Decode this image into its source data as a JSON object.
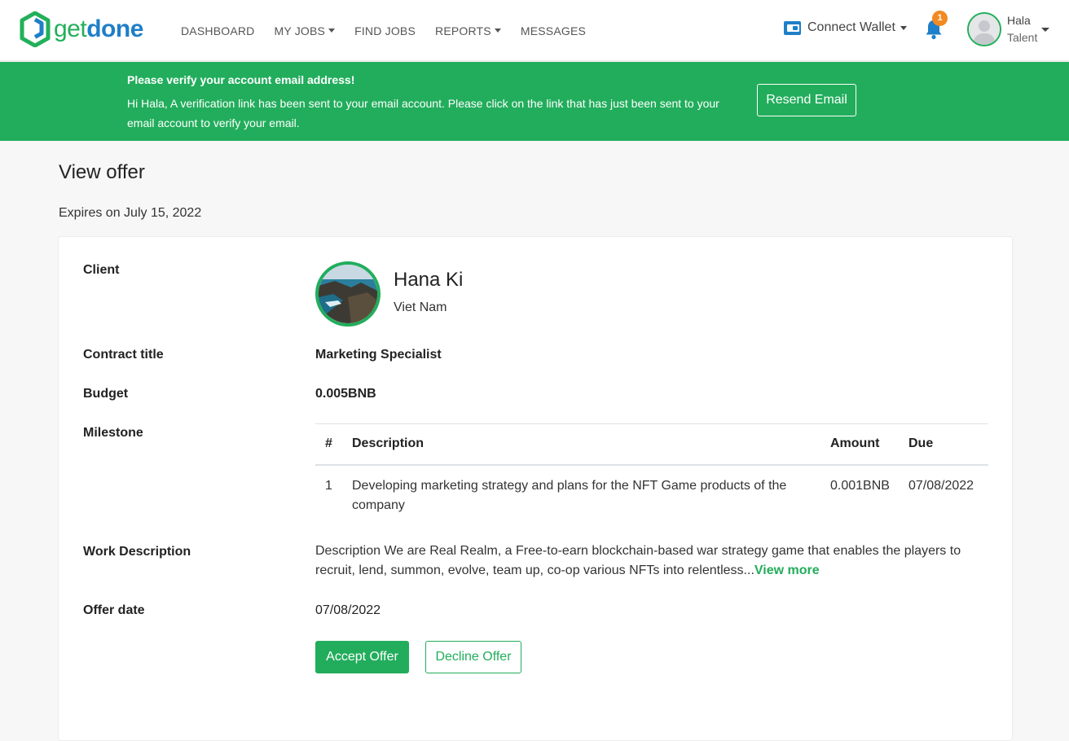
{
  "brand": {
    "get": "get",
    "done": "done"
  },
  "nav": {
    "dashboard": "DASHBOARD",
    "my_jobs": "MY JOBS",
    "find_jobs": "FIND JOBS",
    "reports": "REPORTS",
    "messages": "MESSAGES"
  },
  "wallet": {
    "label": "Connect Wallet"
  },
  "notifications": {
    "count": "1"
  },
  "user": {
    "name": "Hala",
    "role": "Talent"
  },
  "banner": {
    "title": "Please verify your account email address!",
    "text": "Hi Hala, A verification link has been sent to your email account. Please click on the link that has just been sent to your email account to verify your email.",
    "button": "Resend Email"
  },
  "page": {
    "title": "View offer",
    "expires": "Expires on July 15, 2022"
  },
  "offer": {
    "labels": {
      "client": "Client",
      "contract_title": "Contract title",
      "budget": "Budget",
      "milestone": "Milestone",
      "work_description": "Work Description",
      "offer_date": "Offer date"
    },
    "client": {
      "name": "Hana Ki",
      "country": "Viet Nam"
    },
    "contract_title": "Marketing Specialist",
    "budget": "0.005BNB",
    "milestone_headers": {
      "num": "#",
      "description": "Description",
      "amount": "Amount",
      "due": "Due"
    },
    "milestones": [
      {
        "num": "1",
        "description": "Developing marketing strategy and plans for the NFT Game products of the company",
        "amount": "0.001BNB",
        "due": "07/08/2022"
      }
    ],
    "work_description": "Description We are Real Realm, a Free-to-earn blockchain-based war strategy game that enables the players to recruit, lend, summon, evolve, team up, co-op various NFTs into relentless...",
    "view_more": "View more",
    "offer_date": "07/08/2022",
    "accept_label": "Accept Offer",
    "decline_label": "Decline Offer"
  },
  "colors": {
    "brand_green": "#22ad5c",
    "brand_blue": "#1f7fc8",
    "badge_orange": "#f28a22"
  }
}
